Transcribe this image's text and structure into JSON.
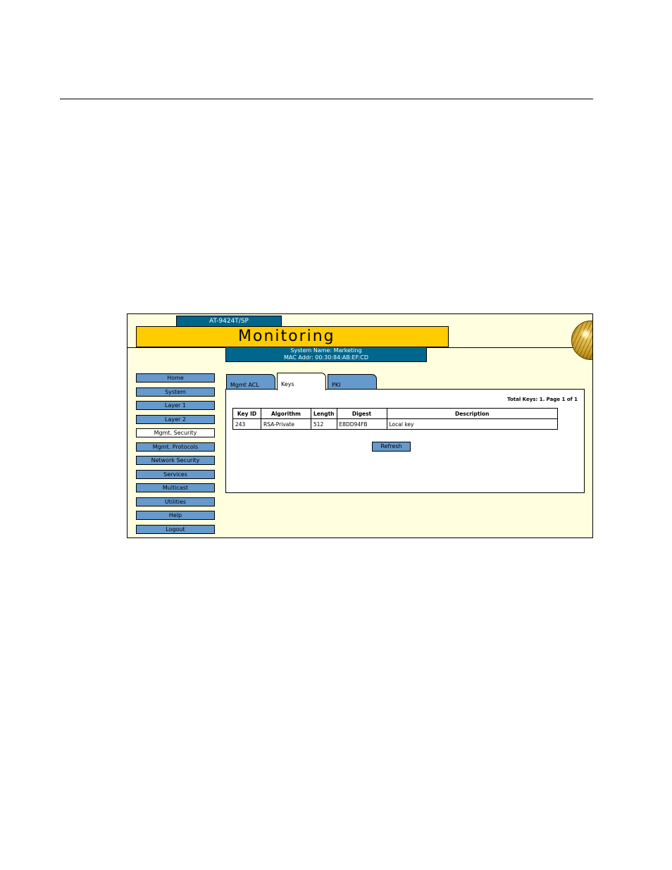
{
  "device": {
    "model": "AT-9424T/SP"
  },
  "banner": {
    "title": "Monitoring"
  },
  "system": {
    "name_line": "System Name: Marketing",
    "mac_line": "MAC Addr: 00:30:84:AB:EF:CD"
  },
  "nav": {
    "items": [
      {
        "label": "Home"
      },
      {
        "label": "System"
      },
      {
        "label": "Layer 1"
      },
      {
        "label": "Layer 2"
      },
      {
        "label": "Mgmt. Security"
      },
      {
        "label": "Mgmt. Protocols"
      },
      {
        "label": "Network Security"
      },
      {
        "label": "Services"
      },
      {
        "label": "Multicast"
      },
      {
        "label": "Utilities"
      },
      {
        "label": "Help"
      },
      {
        "label": "Logout"
      }
    ],
    "active": "Mgmt. Security"
  },
  "tabs": [
    {
      "label": "Mgmt ACL"
    },
    {
      "label": "Keys"
    },
    {
      "label": "PKI"
    }
  ],
  "keys_panel": {
    "summary": "Total Keys: 1. Page 1 of 1",
    "columns": [
      "Key ID",
      "Algorithm",
      "Length",
      "Digest",
      "Description"
    ],
    "rows": [
      {
        "key_id": "243",
        "algorithm": "RSA-Private",
        "length": "512",
        "digest": "E8DD94FB",
        "description": "Local key"
      }
    ],
    "refresh_label": "Refresh"
  }
}
